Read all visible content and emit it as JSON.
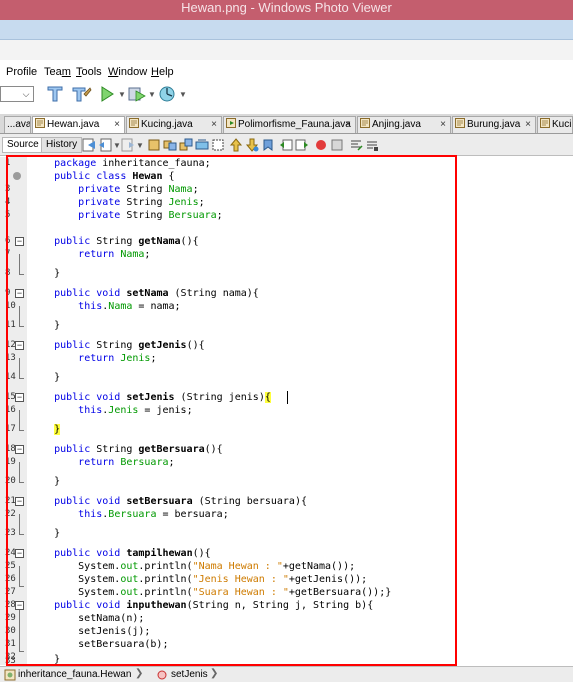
{
  "window": {
    "title": "Hewan.png - Windows Photo Viewer"
  },
  "menubar": {
    "items": [
      {
        "prefix": "Profile",
        "underline": "",
        "suffix": ""
      },
      {
        "prefix": "Tea",
        "underline": "m",
        "suffix": ""
      },
      {
        "prefix": "",
        "underline": "T",
        "suffix": "ools"
      },
      {
        "prefix": "",
        "underline": "W",
        "suffix": "indow"
      },
      {
        "prefix": "",
        "underline": "H",
        "suffix": "elp"
      }
    ]
  },
  "tabs": [
    {
      "label": "...ava",
      "close": ""
    },
    {
      "label": "Hewan.java",
      "close": "×"
    },
    {
      "label": "Kucing.java",
      "close": "×"
    },
    {
      "label": "Polimorfisme_Fauna.java",
      "close": "×"
    },
    {
      "label": "Anjing.java",
      "close": "×"
    },
    {
      "label": "Burung.java",
      "close": "×"
    },
    {
      "label": "Kucir",
      "close": ""
    }
  ],
  "editor_tabs": {
    "source": "Source",
    "history": "History"
  },
  "code_lines": [
    {
      "n": "1",
      "text": "    package inheritance_fauna;"
    },
    {
      "n": "",
      "text": "    public class Hewan {"
    },
    {
      "n": "3",
      "text": "        private String Nama;"
    },
    {
      "n": "4",
      "text": "        private String Jenis;"
    },
    {
      "n": "5",
      "text": "        private String Bersuara;"
    },
    {
      "n": "6",
      "text": "    public String getNama(){"
    },
    {
      "n": "7",
      "text": "        return Nama;"
    },
    {
      "n": "8",
      "text": "    }"
    },
    {
      "n": "9",
      "text": "    public void setNama (String nama){"
    },
    {
      "n": "10",
      "text": "        this.Nama = nama;"
    },
    {
      "n": "11",
      "text": "    }"
    },
    {
      "n": "12",
      "text": "    public String getJenis(){"
    },
    {
      "n": "13",
      "text": "        return Jenis;"
    },
    {
      "n": "14",
      "text": "    }"
    },
    {
      "n": "15",
      "text": "    public void setJenis (String jenis){"
    },
    {
      "n": "16",
      "text": "        this.Jenis = jenis;"
    },
    {
      "n": "17",
      "text": "    }"
    },
    {
      "n": "18",
      "text": "    public String getBersuara(){"
    },
    {
      "n": "19",
      "text": "        return Bersuara;"
    },
    {
      "n": "20",
      "text": "    }"
    },
    {
      "n": "21",
      "text": "    public void setBersuara (String bersuara){"
    },
    {
      "n": "22",
      "text": "        this.Bersuara = bersuara;"
    },
    {
      "n": "23",
      "text": "    }"
    },
    {
      "n": "24",
      "text": "    public void tampilhewan(){"
    },
    {
      "n": "25",
      "text": "        System.out.println(\"Nama Hewan : \"+getNama());"
    },
    {
      "n": "26",
      "text": "        System.out.println(\"Jenis Hewan : \"+getJenis());"
    },
    {
      "n": "27",
      "text": "        System.out.println(\"Suara Hewan : \"+getBersuara());}"
    },
    {
      "n": "28",
      "text": "    public void inputhewan(String n, String j, String b){"
    },
    {
      "n": "29",
      "text": "        setNama(n);"
    },
    {
      "n": "30",
      "text": "        setJenis(j);"
    },
    {
      "n": "31",
      "text": "        setBersuara(b);"
    },
    {
      "n": "32",
      "text": "    }"
    },
    {
      "n": "33",
      "text": "    }"
    }
  ],
  "breadcrumbs": {
    "class": "inheritance_fauna.Hewan",
    "method": "setJenis"
  },
  "colors": {
    "keyword": "#0000e6",
    "field": "#009900",
    "string": "#ce7b00",
    "highlight": "#ffff3c",
    "annotation_box": "#ff0000"
  }
}
